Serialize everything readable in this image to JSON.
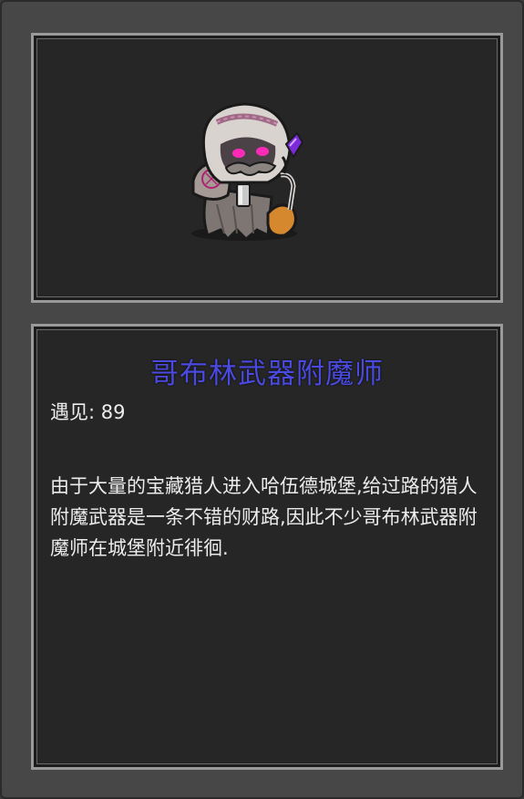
{
  "creature": {
    "name": "哥布林武器附魔师",
    "encounter_label": "遇见: ",
    "encounter_count": "89",
    "description": "由于大量的宝藏猎人进入哈伍德城堡,给过路的猎人附魔武器是一条不错的财路,因此不少哥布林武器附魔师在城堡附近徘徊."
  },
  "colors": {
    "title": "#4a4ae0",
    "text": "#ececec",
    "panel_bg": "#262626",
    "frame_bg": "#474747"
  },
  "icons": {
    "portrait": "goblin-enchanter-portrait"
  }
}
